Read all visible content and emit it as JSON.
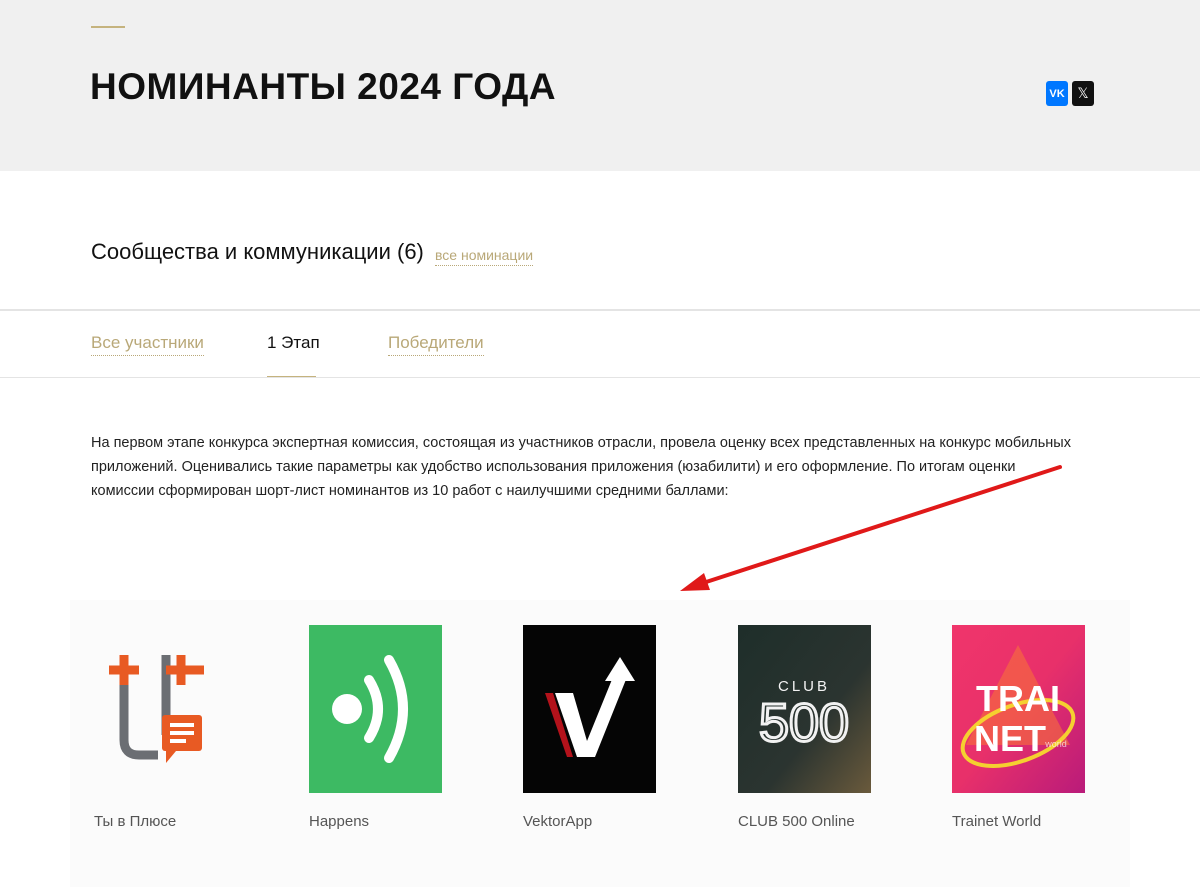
{
  "hero": {
    "title": "НОМИНАНТЫ 2024 ГОДА",
    "social": [
      {
        "name": "vk",
        "label": "VK",
        "icon": "vk-icon",
        "color": "#0077ff"
      },
      {
        "name": "x",
        "label": "𝕏",
        "icon": "x-icon",
        "color": "#111111"
      }
    ]
  },
  "category": {
    "title": "Сообщества и коммуникации (6)",
    "all_link": "все номинации"
  },
  "tabs": [
    {
      "label": "Все участники",
      "active": false
    },
    {
      "label": "1 Этап",
      "active": true
    },
    {
      "label": "Победители",
      "active": false
    }
  ],
  "description": "На первом этапе конкурса экспертная комиссия, состоящая из участников отрасли, провела оценку всех представленных на конкурс мобильных приложений. Оценивались такие параметры как удобство использования приложения (юзабилити) и его оформление. По итогам оценки комиссии сформирован шорт-лист номинантов из 10 работ с наилучшими средними баллами:",
  "nominees": [
    {
      "name": "Ты в Плюсе",
      "logo_icon": "ty-v-pluse-logo"
    },
    {
      "name": "Happens",
      "logo_icon": "happens-logo"
    },
    {
      "name": "VektorApp",
      "logo_icon": "vektorapp-logo"
    },
    {
      "name": "CLUB 500 Online",
      "logo_icon": "club500-logo",
      "logo_text_top": "CLUB",
      "logo_text_main": "500"
    },
    {
      "name": "Trainet World",
      "logo_icon": "trainet-logo",
      "logo_text_top": "TRAI",
      "logo_text_bottom": "NET",
      "logo_text_small": "world"
    }
  ],
  "colors": {
    "accent": "#c5b37e",
    "link": "#b9a878",
    "hero_bg": "#f0f0f0",
    "annotation_arrow": "#e01919"
  }
}
